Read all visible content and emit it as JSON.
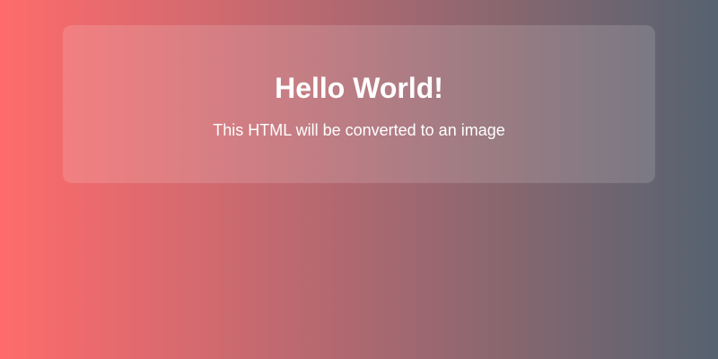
{
  "colors": {
    "gradient_start": "#ff6b6b",
    "gradient_end": "#556270",
    "text": "#ffffff"
  },
  "card": {
    "title": "Hello World!",
    "subtitle": "This HTML will be converted to an image"
  }
}
